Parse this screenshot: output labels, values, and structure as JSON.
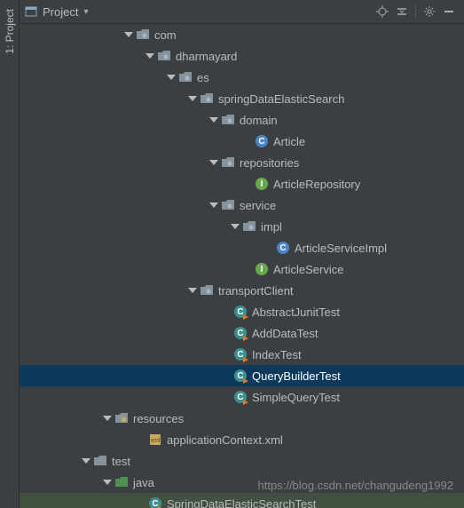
{
  "sidebar": {
    "tab": "1: Project"
  },
  "toolbar": {
    "title": "Project"
  },
  "tree": [
    {
      "indent": 140,
      "arrow": true,
      "icon": "folder",
      "label": "com"
    },
    {
      "indent": 164,
      "arrow": true,
      "icon": "folder",
      "label": "dharmayard"
    },
    {
      "indent": 188,
      "arrow": true,
      "icon": "folder",
      "label": "es"
    },
    {
      "indent": 212,
      "arrow": true,
      "icon": "folder",
      "label": "springDataElasticSearch"
    },
    {
      "indent": 236,
      "arrow": true,
      "icon": "folder",
      "label": "domain"
    },
    {
      "indent": 274,
      "arrow": false,
      "icon": "c",
      "label": "Article"
    },
    {
      "indent": 236,
      "arrow": true,
      "icon": "folder",
      "label": "repositories"
    },
    {
      "indent": 274,
      "arrow": false,
      "icon": "i",
      "label": "ArticleRepository"
    },
    {
      "indent": 236,
      "arrow": true,
      "icon": "folder",
      "label": "service"
    },
    {
      "indent": 260,
      "arrow": true,
      "icon": "folder",
      "label": "impl"
    },
    {
      "indent": 298,
      "arrow": false,
      "icon": "c",
      "label": "ArticleServiceImpl"
    },
    {
      "indent": 274,
      "arrow": false,
      "icon": "i",
      "label": "ArticleService"
    },
    {
      "indent": 212,
      "arrow": true,
      "icon": "folder",
      "label": "transportClient"
    },
    {
      "indent": 250,
      "arrow": false,
      "icon": "run",
      "label": "AbstractJunitTest"
    },
    {
      "indent": 250,
      "arrow": false,
      "icon": "run",
      "label": "AddDataTest"
    },
    {
      "indent": 250,
      "arrow": false,
      "icon": "run",
      "label": "IndexTest"
    },
    {
      "indent": 250,
      "arrow": false,
      "icon": "run",
      "label": "QueryBuilderTest",
      "selected": true
    },
    {
      "indent": 250,
      "arrow": false,
      "icon": "run",
      "label": "SimpleQueryTest"
    },
    {
      "indent": 116,
      "arrow": true,
      "icon": "resources",
      "label": "resources"
    },
    {
      "indent": 154,
      "arrow": false,
      "icon": "xml",
      "label": "applicationContext.xml"
    },
    {
      "indent": 92,
      "arrow": true,
      "icon": "folder-plain",
      "label": "test"
    },
    {
      "indent": 116,
      "arrow": true,
      "icon": "folder-green",
      "label": "java"
    },
    {
      "indent": 154,
      "arrow": false,
      "icon": "run",
      "label": "SpringDataElasticSearchTest",
      "darksel": true
    }
  ],
  "watermark": "https://blog.csdn.net/changudeng1992"
}
